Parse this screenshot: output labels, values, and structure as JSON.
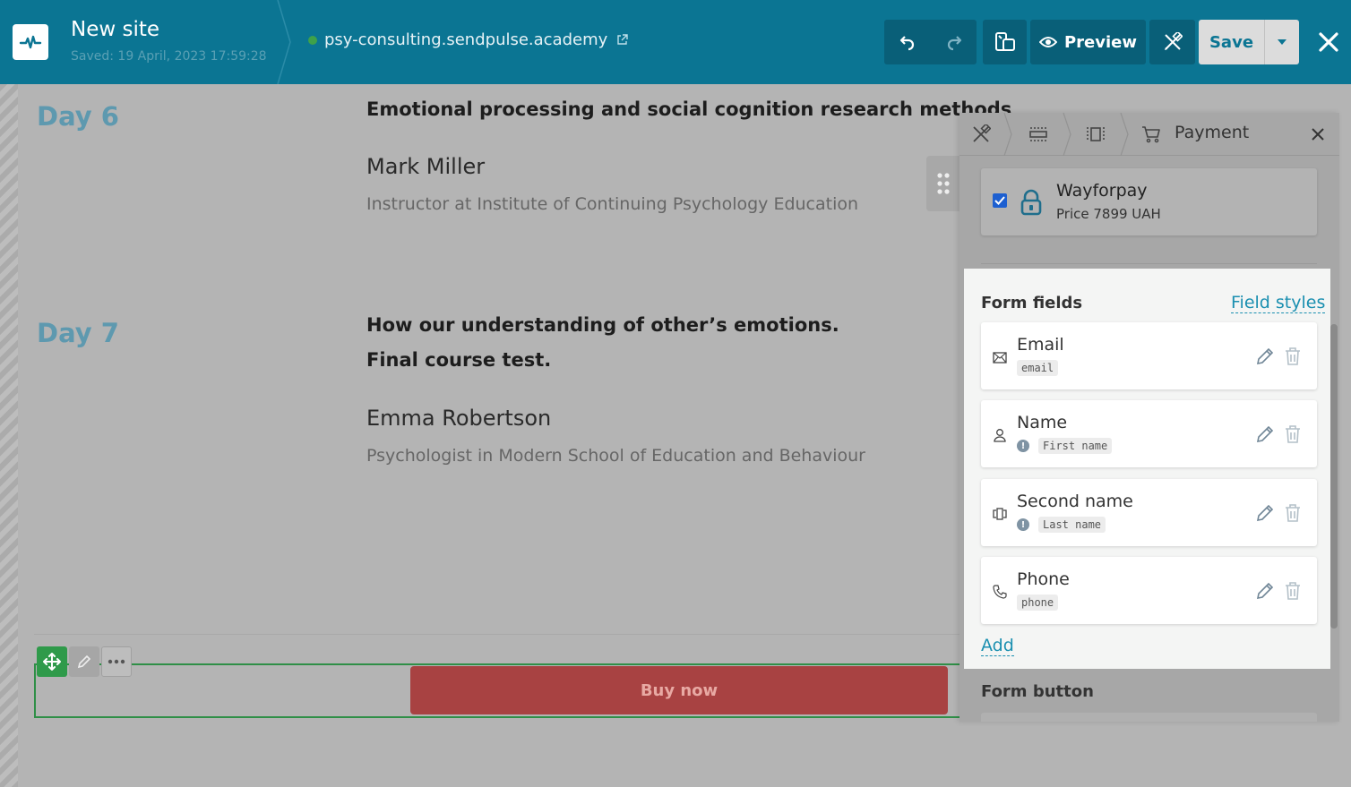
{
  "topbar": {
    "title": "New site",
    "saved_text": "Saved: 19 April, 2023 17:59:28",
    "domain": "psy-consulting.sendpulse.academy",
    "preview_label": "Preview",
    "save_label": "Save"
  },
  "canvas": {
    "day6": {
      "label": "Day 6",
      "topic": "Emotional processing and social cognition research methods",
      "speaker": "Mark Miller",
      "role": "Instructor at Institute of Continuing Psychology Education"
    },
    "day7": {
      "label": "Day 7",
      "topic_line1": "How our understanding of other’s emotions.",
      "topic_line2": "Final course test.",
      "speaker": "Emma Robertson",
      "role": "Psychologist in Modern School of Education and Behaviour"
    },
    "buy_button": "Buy now"
  },
  "panel": {
    "title": "Payment",
    "payment": {
      "name": "Wayforpay",
      "price": "Price 7899 UAH",
      "checked": true
    },
    "form_fields": {
      "title": "Form fields",
      "styles_link": "Field styles",
      "fields": [
        {
          "label": "Email",
          "tag": "email",
          "icon": "envelope-icon",
          "warning": false
        },
        {
          "label": "Name",
          "tag": "First name",
          "icon": "person-icon",
          "warning": true
        },
        {
          "label": "Second name",
          "tag": "Last name",
          "icon": "id-card-icon",
          "warning": true
        },
        {
          "label": "Phone",
          "tag": "phone",
          "icon": "phone-icon",
          "warning": false
        }
      ],
      "add_label": "Add"
    },
    "form_button_title": "Form button"
  },
  "colors": {
    "topbar": "#0b7593",
    "accent_link": "#1a8fb0",
    "buy_button": "#a84242",
    "selection": "#2f8f47"
  }
}
